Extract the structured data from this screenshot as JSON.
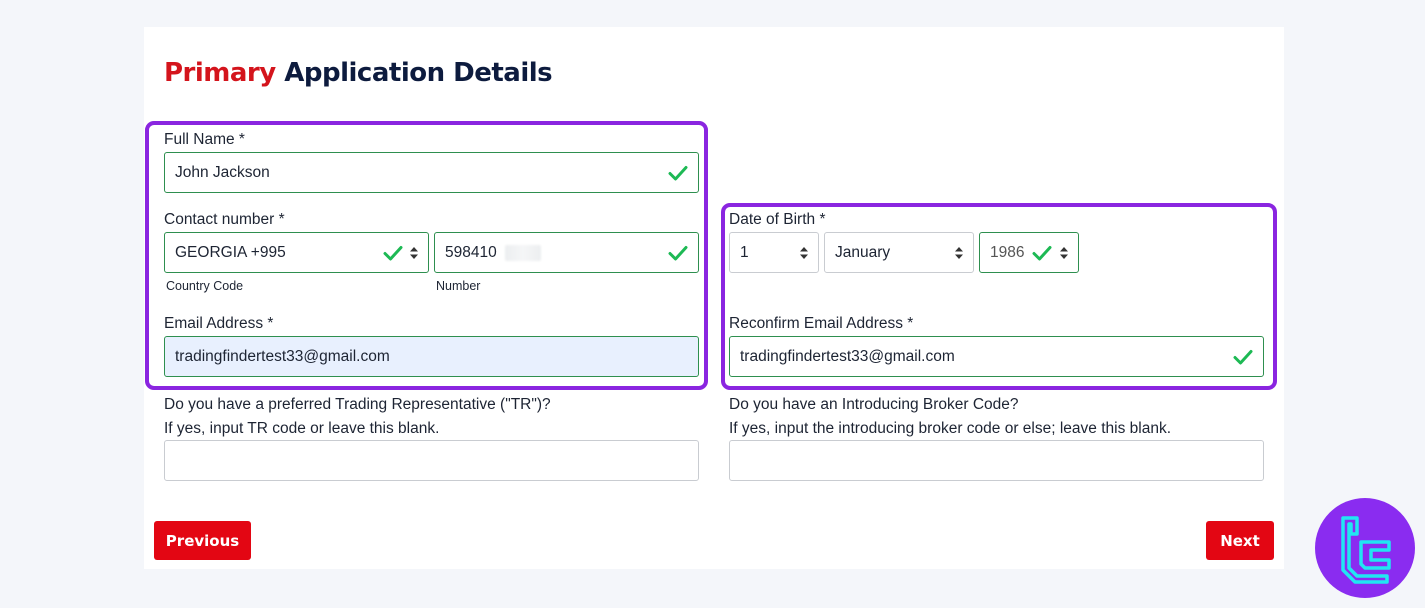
{
  "title": {
    "accent": "Primary",
    "rest": "Application Details"
  },
  "full_name": {
    "label": "Full Name *",
    "value": "John Jackson"
  },
  "contact": {
    "label": "Contact number *",
    "country_value": "GEORGIA +995",
    "country_sublabel": "Country Code",
    "number_value": "598410",
    "number_sublabel": "Number"
  },
  "email": {
    "label": "Email Address *",
    "value": "tradingfindertest33@gmail.com"
  },
  "dob": {
    "label": "Date of Birth *",
    "day": "1",
    "month": "January",
    "year": "1986"
  },
  "reconfirm_email": {
    "label": "Reconfirm Email Address *",
    "value": "tradingfindertest33@gmail.com"
  },
  "tr": {
    "question": "Do you have a preferred Trading Representative (\"TR\")?",
    "hint": "If yes, input TR code or leave this blank.",
    "value": ""
  },
  "ib": {
    "question": "Do you have an Introducing Broker Code?",
    "hint": "If yes, input the introducing broker code or else; leave this blank.",
    "value": ""
  },
  "buttons": {
    "previous": "Previous",
    "next": "Next"
  },
  "colors": {
    "accent_red": "#d4141c",
    "button_red": "#e30613",
    "valid_green": "#2e8f4f",
    "check_green": "#1db954",
    "highlight_purple": "#8a25e0",
    "logo_purple": "#8a2cf0",
    "logo_cyan": "#21e6f2"
  },
  "icons": {
    "valid": "check-icon",
    "select": "select-arrows-icon",
    "logo": "tradingfinder-logo"
  }
}
